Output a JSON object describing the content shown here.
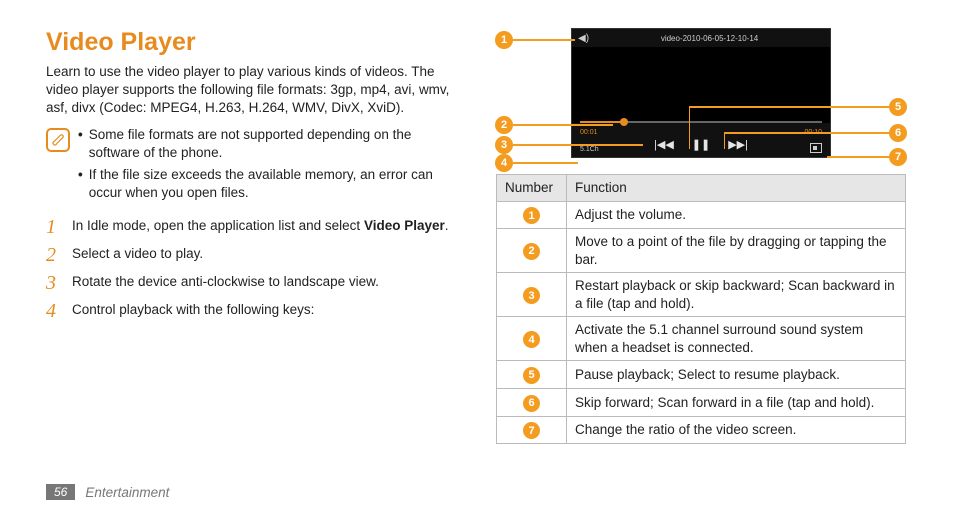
{
  "title": "Video Player",
  "intro": "Learn to use the video player to play various kinds of videos. The video player supports the following file formats: 3gp, mp4, avi, wmv, asf, divx (Codec: MPEG4, H.263, H.264, WMV, DivX, XviD).",
  "notes": [
    "Some file formats are not supported depending on the software of the phone.",
    "If the file size exceeds the available memory, an error can occur when you open files."
  ],
  "steps": {
    "s1_pre": "In Idle mode, open the application list and select ",
    "s1_bold": "Video Player",
    "s1_post": ".",
    "s2": "Select a video to play.",
    "s3": "Rotate the device anti-clockwise to landscape view.",
    "s4": "Control playback with the following keys:"
  },
  "footer": {
    "page": "56",
    "section": "Entertainment"
  },
  "player": {
    "filename": "video-2010-06-05-12-10-14",
    "time_elapsed": "00:01",
    "time_total": "00:10",
    "sound_label": "5.1Ch"
  },
  "table": {
    "headers": {
      "num": "Number",
      "fn": "Function"
    },
    "rows": [
      {
        "n": "1",
        "fn": "Adjust the volume."
      },
      {
        "n": "2",
        "fn": "Move to a point of the file by dragging or tapping the bar."
      },
      {
        "n": "3",
        "fn": "Restart playback or skip backward; Scan backward in a file (tap and hold)."
      },
      {
        "n": "4",
        "fn": "Activate the 5.1 channel surround sound system when a headset is connected."
      },
      {
        "n": "5",
        "fn": "Pause playback; Select to resume playback."
      },
      {
        "n": "6",
        "fn": "Skip forward; Scan forward in a file (tap and hold)."
      },
      {
        "n": "7",
        "fn": "Change the ratio of the video screen."
      }
    ]
  }
}
